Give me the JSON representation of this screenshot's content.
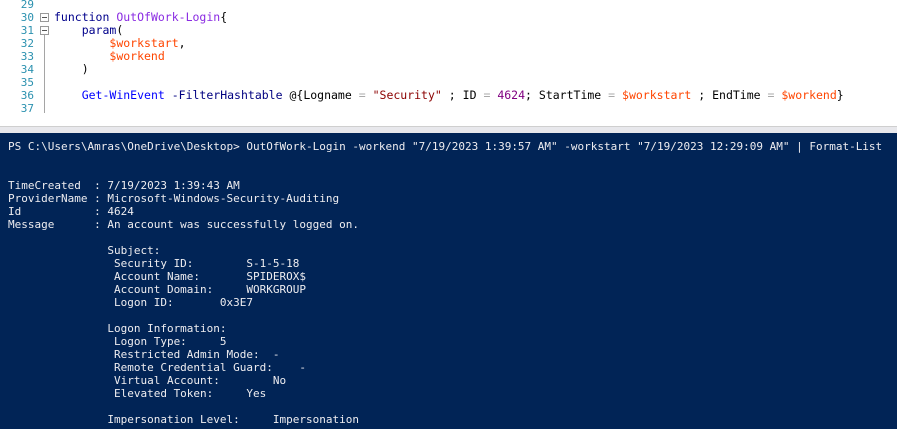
{
  "editor": {
    "line_numbers": [
      "29",
      "30",
      "31",
      "32",
      "33",
      "34",
      "35",
      "36",
      "37"
    ],
    "line30": {
      "kw": "function",
      "name": "OutOfWork-Login",
      "brace": "{"
    },
    "line31": {
      "kw": "param",
      "paren": "("
    },
    "line32": {
      "var": "$workstart",
      "comma": ","
    },
    "line33": {
      "var": "$workend"
    },
    "line34": {
      "paren": ")"
    },
    "line36": {
      "cmd": "Get-WinEvent",
      "param": "-FilterHashtable",
      "open": "@{",
      "k1": "Logname",
      "eq1": "=",
      "v1": "\"Security\"",
      "sep1": ";",
      "k2": "ID",
      "eq2": "=",
      "v2": "4624",
      "sep2": ";",
      "k3": "StartTime",
      "eq3": "=",
      "v3": "$workstart",
      "sep3": ";",
      "k4": "EndTime",
      "eq4": "=",
      "v4": "$workend",
      "close": "}"
    }
  },
  "console": {
    "lines": [
      "PS C:\\Users\\Amras\\OneDrive\\Desktop> OutOfWork-Login -workend \"7/19/2023 1:39:57 AM\" -workstart \"7/19/2023 12:29:09 AM\" | Format-List",
      "",
      "",
      "TimeCreated  : 7/19/2023 1:39:43 AM",
      "ProviderName : Microsoft-Windows-Security-Auditing",
      "Id           : 4624",
      "Message      : An account was successfully logged on.",
      "",
      "               Subject:",
      "                Security ID:        S-1-5-18",
      "                Account Name:       SPIDEROX$",
      "                Account Domain:     WORKGROUP",
      "                Logon ID:       0x3E7",
      "",
      "               Logon Information:",
      "                Logon Type:     5",
      "                Restricted Admin Mode:  -",
      "                Remote Credential Guard:    -",
      "                Virtual Account:        No",
      "                Elevated Token:     Yes",
      "",
      "               Impersonation Level:     Impersonation"
    ]
  },
  "colors": {
    "console_bg": "#012456",
    "console_fg": "#eeedf0",
    "keyword": "#00008b",
    "function_name": "#8a2be2",
    "variable": "#ff4500",
    "command": "#0000ff",
    "string": "#8b0000",
    "number": "#800080",
    "line_number": "#2b91af"
  }
}
